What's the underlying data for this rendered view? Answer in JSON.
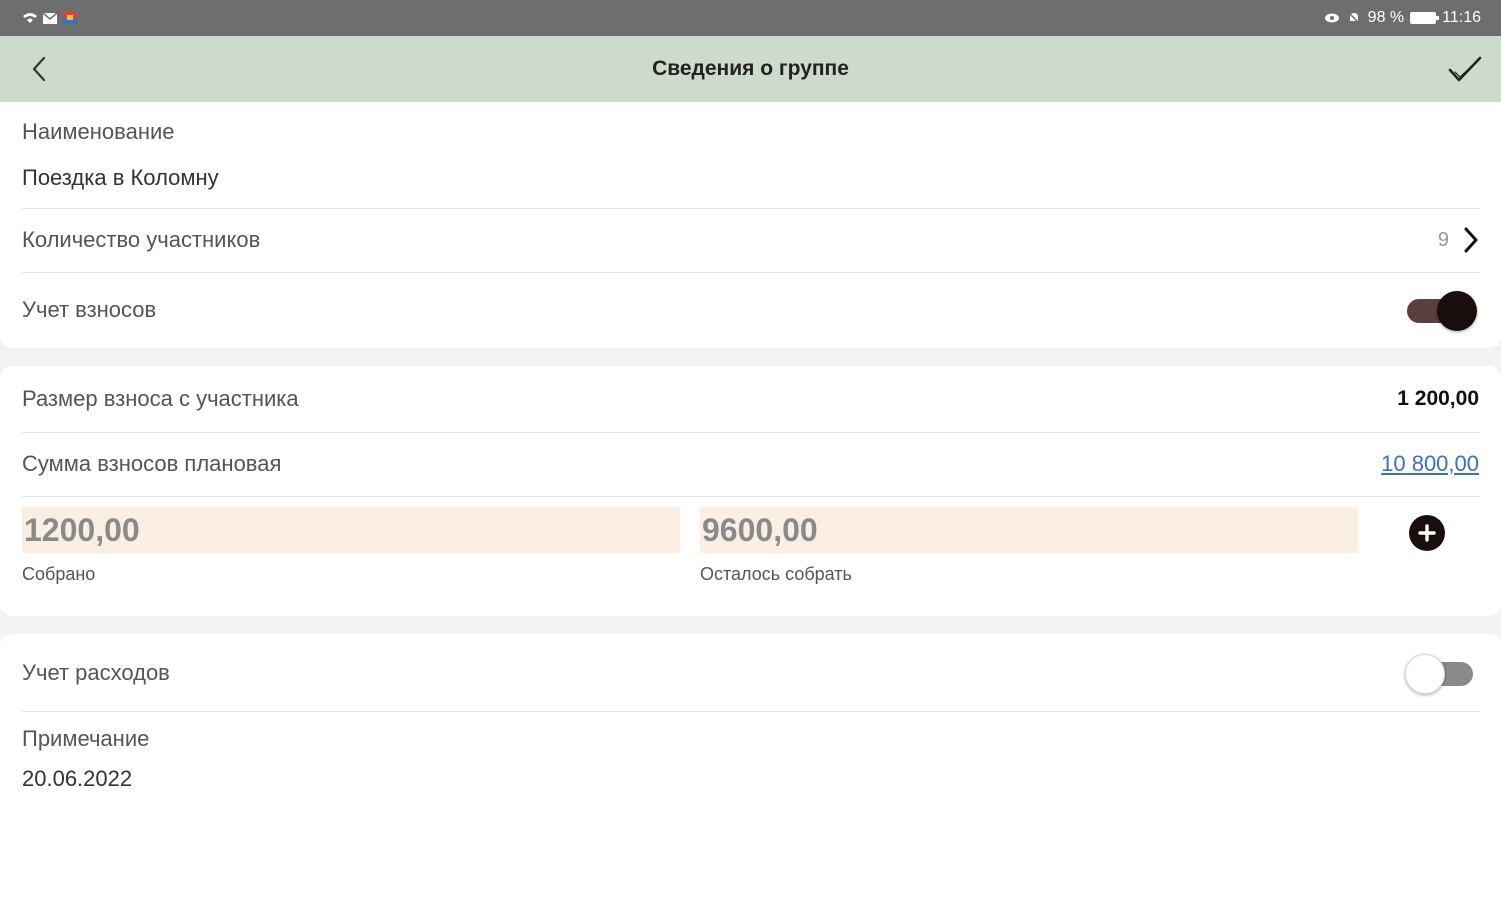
{
  "status_bar": {
    "battery": "98 %",
    "time": "11:16"
  },
  "header": {
    "title": "Сведения о группе",
    "back_icon": "chevron-left-icon",
    "save_icon": "check-icon"
  },
  "group": {
    "name_label": "Наименование",
    "name_value": "Поездка в Коломну",
    "participants_label": "Количество участников",
    "participants_count": "9",
    "contributions_label": "Учет взносов",
    "contributions_enabled": true
  },
  "contributions": {
    "fee_label": "Размер взноса с участника",
    "fee_value": "1 200,00",
    "planned_label": "Сумма взносов плановая",
    "planned_value": "10 800,00",
    "collected_value": "1200,00",
    "collected_label": "Собрано",
    "remaining_value": "9600,00",
    "remaining_label": "Осталось собрать",
    "add_icon": "plus-circle-icon"
  },
  "expenses": {
    "label": "Учет расходов",
    "enabled": false
  },
  "note": {
    "label": "Примечание",
    "value": "20.06.2022"
  },
  "colors": {
    "appbar": "#cddbcc",
    "statusbar": "#6e6e6e",
    "accent_dark": "#1a0d0d",
    "link": "#3a6fc4",
    "field_bg": "#fbefe4"
  }
}
